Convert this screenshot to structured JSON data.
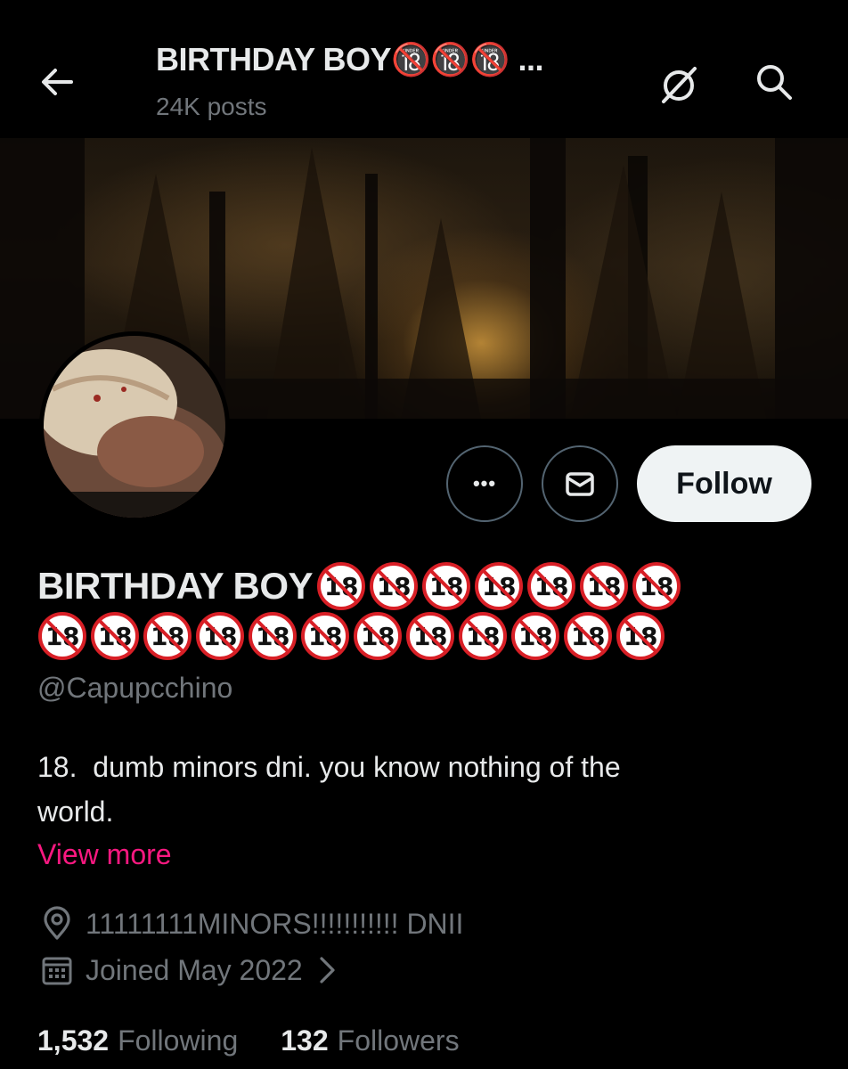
{
  "header": {
    "title": "BIRTHDAY BOY🔞🔞🔞 ...",
    "post_count": "24K posts",
    "back_icon": "arrow-left-icon",
    "status_icon": "no-follow-icon",
    "search_icon": "search-icon"
  },
  "profile": {
    "display_name_text": "BIRTHDAY BOY",
    "display_name_full": "BIRTHDAY BOY🔞🔞🔞🔞🔞🔞🔞🔞🔞🔞🔞🔞🔞🔞🔞🔞🔞🔞🔞",
    "handle": "@Capupcchino",
    "bio": "18.  dumb minors dni. you know nothing of the\nworld.",
    "view_more": "View more",
    "location": "11111111MINORS!!!!!!!!!!! DNII",
    "joined": "Joined May 2022"
  },
  "actions": {
    "more_label": "•••",
    "follow_label": "Follow"
  },
  "stats": {
    "following_count": "1,532",
    "following_label": "Following",
    "followers_count": "132",
    "followers_label": "Followers"
  },
  "colors": {
    "background": "#000000",
    "text_primary": "#e7e9ea",
    "text_secondary": "#71767b",
    "accent_link": "#f91880",
    "follow_button_bg": "#eff3f4"
  }
}
